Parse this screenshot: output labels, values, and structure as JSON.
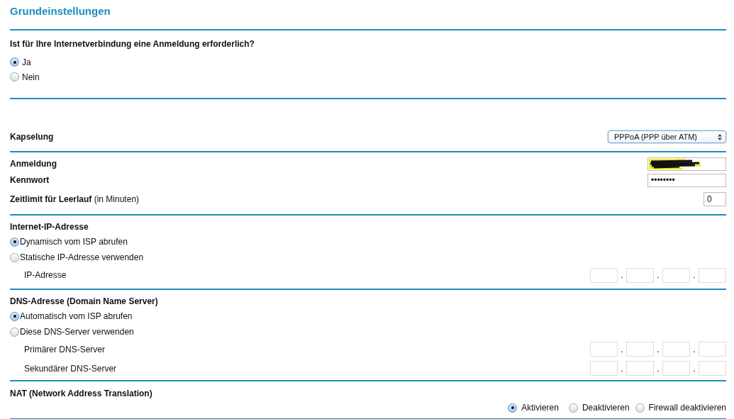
{
  "title": "Grundeinstellungen",
  "login_required": {
    "question": "Ist für Ihre Internetverbindung eine Anmeldung erforderlich?",
    "options": [
      {
        "label": "Ja",
        "selected": true
      },
      {
        "label": "Nein",
        "selected": false
      }
    ]
  },
  "encapsulation": {
    "label": "Kapselung",
    "value": "PPPoA (PPP über ATM)"
  },
  "account": [
    {
      "kind": "text",
      "label": "**Anmeldung**",
      "redacted": true
    },
    {
      "kind": "text",
      "label": "**Kennwort**",
      "value": "••••••••",
      "redacted": false
    },
    {
      "kind": "short",
      "label": "**Zeitlimit für Leerlauf** (in Minuten)",
      "value": "0"
    }
  ],
  "internet_ip": {
    "heading": "Internet-IP-Adresse",
    "options": [
      {
        "label": "Dynamisch vom ISP abrufen",
        "selected": true
      },
      {
        "label": "Statische IP-Adresse verwenden",
        "selected": false
      }
    ],
    "address_rows": [
      {
        "label": "IP-Adresse",
        "separators": [
          ".",
          ".",
          "."
        ]
      }
    ]
  },
  "dns": {
    "heading": "DNS-Adresse (Domain Name Server)",
    "options": [
      {
        "label": "Automatisch vom ISP abrufen",
        "selected": true
      },
      {
        "label": "Diese DNS-Server verwenden",
        "selected": false
      }
    ],
    "address_rows": [
      {
        "label": "Primärer DNS-Server",
        "separators": [
          ".",
          ".",
          "."
        ]
      },
      {
        "label": "Sekundärer DNS-Server",
        "separators": [
          ".",
          ".",
          "."
        ]
      }
    ]
  },
  "nat": {
    "heading": "NAT (Network Address Translation)",
    "options": [
      {
        "label": "Aktivieren",
        "selected": true
      },
      {
        "label": "Deaktivieren",
        "selected": false
      },
      {
        "label": "Firewall deaktivieren",
        "selected": false
      }
    ]
  }
}
